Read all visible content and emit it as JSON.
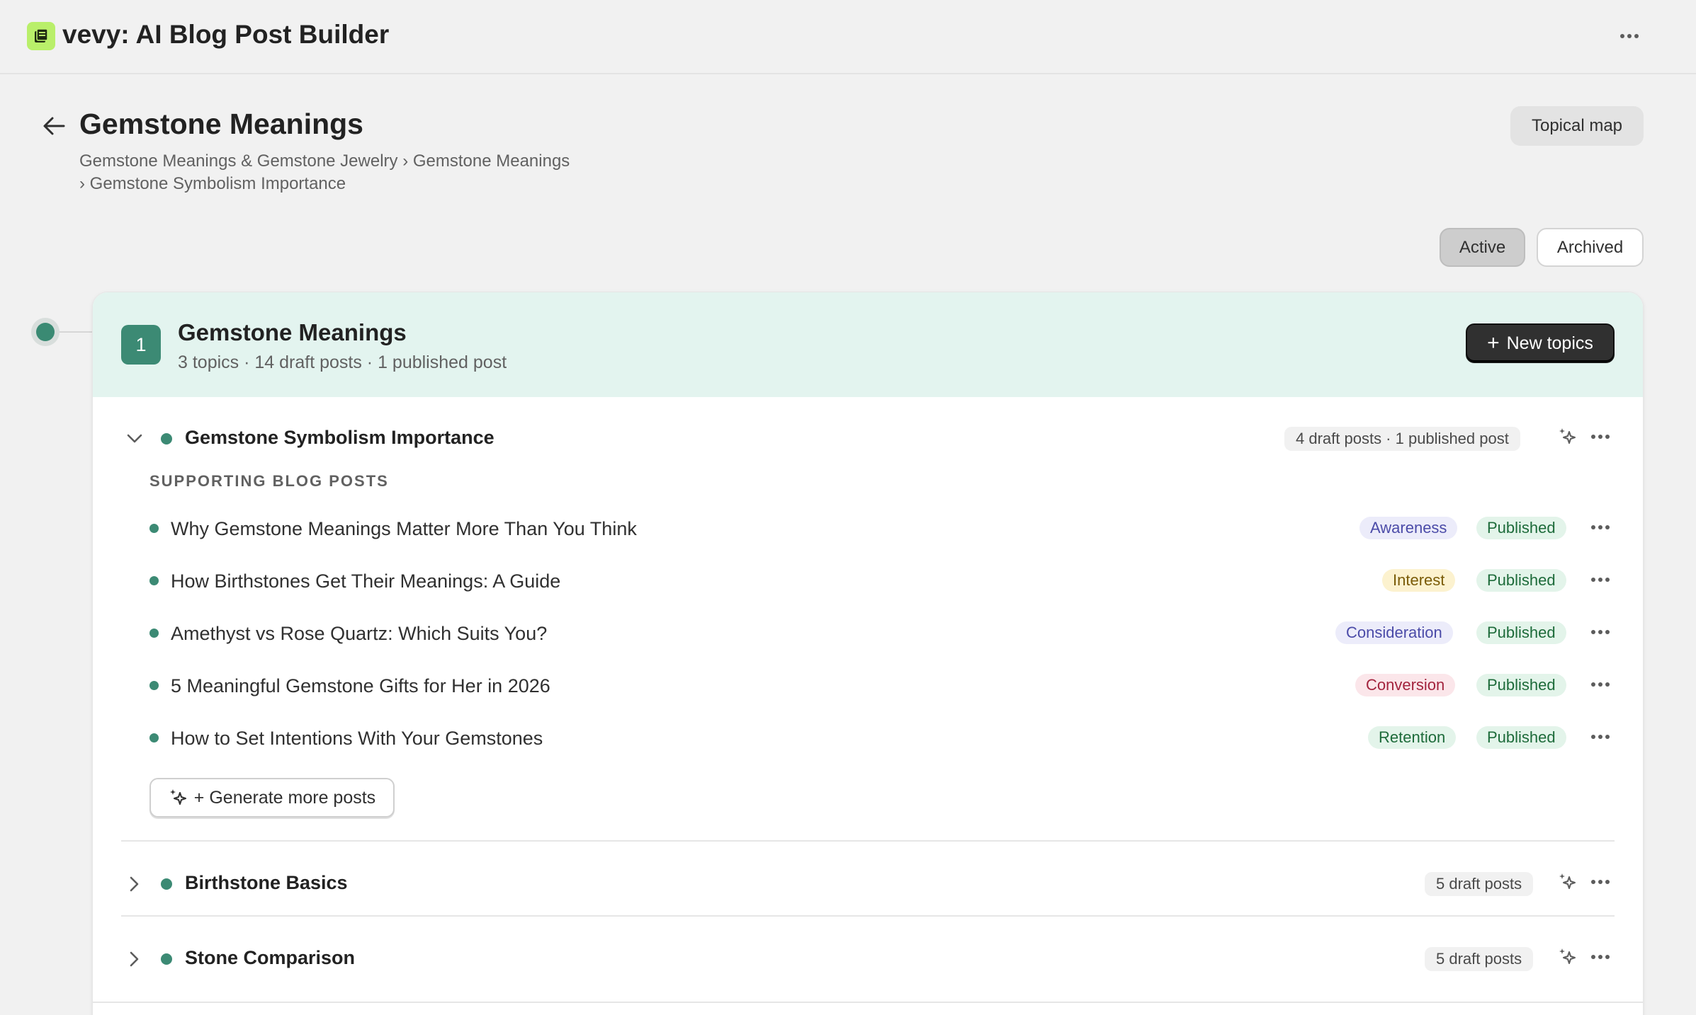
{
  "app": {
    "title": "vevy: AI Blog Post Builder"
  },
  "page": {
    "title": "Gemstone Meanings",
    "breadcrumb_line1": "Gemstone Meanings & Gemstone Jewelry › Gemstone Meanings",
    "breadcrumb_line2": "› Gemstone Symbolism Importance",
    "topical_map_label": "Topical map",
    "filter": {
      "active_label": "Active",
      "archived_label": "Archived",
      "selected": "Active"
    }
  },
  "group": {
    "number": "1",
    "title": "Gemstone Meanings",
    "subtitle": "3 topics · 14 draft posts · 1 published post",
    "new_topics_label": "New topics"
  },
  "colors": {
    "accent": "#3c8a74",
    "header_bg": "#e3f4ef",
    "logo_bg": "#b9ef6a"
  },
  "topics": [
    {
      "title": "Gemstone Symbolism Importance",
      "counts": "4 draft posts · 1 published post",
      "expanded": true,
      "section_label": "SUPPORTING BLOG POSTS",
      "posts": [
        {
          "title": "Why Gemstone Meanings Matter More Than You Think",
          "stage": "Awareness",
          "status": "Published"
        },
        {
          "title": "How Birthstones Get Their Meanings: A Guide",
          "stage": "Interest",
          "status": "Published"
        },
        {
          "title": "Amethyst vs Rose Quartz: Which Suits You?",
          "stage": "Consideration",
          "status": "Published"
        },
        {
          "title": "5 Meaningful Gemstone Gifts for Her in 2026",
          "stage": "Conversion",
          "status": "Published"
        },
        {
          "title": "How to Set Intentions With Your Gemstones",
          "stage": "Retention",
          "status": "Published"
        }
      ],
      "generate_label": "+ Generate more posts"
    },
    {
      "title": "Birthstone Basics",
      "counts": "5 draft posts",
      "expanded": false
    },
    {
      "title": "Stone Comparison",
      "counts": "5 draft posts",
      "expanded": false
    }
  ],
  "icons": [
    "app-logo-icon",
    "more-icon",
    "back-arrow-icon",
    "plus-icon",
    "chevron-down-icon",
    "chevron-right-icon",
    "sparkle-icon"
  ]
}
